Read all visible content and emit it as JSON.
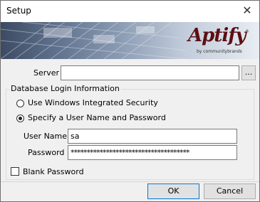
{
  "window": {
    "title": "Setup",
    "close_glyph": "✕"
  },
  "banner": {
    "logo_text": "Aptify",
    "logo_trademark": "®",
    "logo_tagline": "by communitybrands"
  },
  "server": {
    "label": "Server",
    "value": "",
    "browse_label": "..."
  },
  "login_group": {
    "legend": "Database Login Information",
    "options": [
      {
        "label": "Use Windows Integrated Security",
        "selected": false
      },
      {
        "label": "Specify a User Name and Password",
        "selected": true
      }
    ],
    "username_label": "User Name",
    "username_value": "sa",
    "password_label": "Password",
    "password_value": "*************************************",
    "blank_password_label": "Blank Password",
    "blank_password_checked": false
  },
  "buttons": {
    "ok": "OK",
    "cancel": "Cancel"
  },
  "colors": {
    "logo": "#5c0f12",
    "banner_dark": "#3c4b62",
    "banner_light": "#e9edf3"
  }
}
